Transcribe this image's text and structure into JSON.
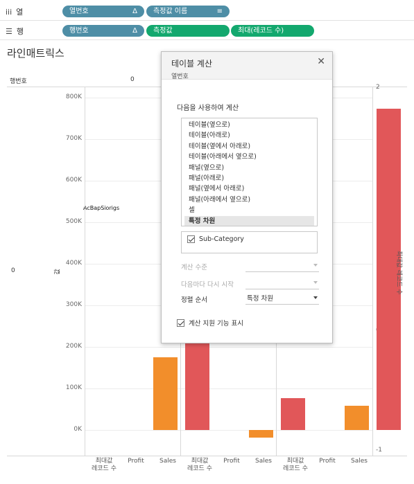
{
  "shelves": {
    "columns": {
      "label": "열",
      "pills": [
        {
          "text": "열번호",
          "mark": "Δ"
        },
        {
          "text": "측정값 이름",
          "mark": ""
        }
      ]
    },
    "rows": {
      "label": "행",
      "pills": [
        {
          "text": "행번호",
          "mark": "Δ"
        },
        {
          "text": "측정값",
          "mark": ""
        },
        {
          "text": "최대(레코드 수)",
          "mark": ""
        }
      ]
    }
  },
  "sheet": {
    "title": "라인매트릭스"
  },
  "chart_header": {
    "row_header_label": "행번호",
    "col_value": "0",
    "row_value": "0",
    "left_axis_title": "값",
    "right_axis_title": "최대값 레코드 수",
    "overlap_text": "AcBapSiorigs"
  },
  "chart_data": {
    "type": "bar",
    "left_axis": {
      "ticks": [
        "800K",
        "700K",
        "600K",
        "500K",
        "400K",
        "300K",
        "200K",
        "100K",
        "0K"
      ]
    },
    "right_axis": {
      "ticks": [
        "2",
        "1",
        "0",
        "-1"
      ]
    },
    "panes": [
      {
        "categories": [
          "최대값 레코드 수",
          "Profit",
          "Sales"
        ],
        "values": [
          0,
          175000,
          738000
        ]
      },
      {
        "categories": [
          "최대값 레코드 수",
          "Profit",
          "Sales"
        ],
        "values": [
          0,
          -19000,
          76000
        ]
      },
      {
        "categories": [
          "최대값 레코드 수",
          "Profit",
          "Sales"
        ],
        "values": [
          0,
          58000,
          773000
        ]
      }
    ],
    "colors": {
      "Profit": "#f28e2b",
      "Sales": "#e15759"
    },
    "x_labels": [
      {
        "line1": "최대값",
        "line2": "레코드 수"
      },
      {
        "line1": "Profit",
        "line2": ""
      },
      {
        "line1": "Sales",
        "line2": ""
      },
      {
        "line1": "최대값",
        "line2": "레코드 수"
      },
      {
        "line1": "Profit",
        "line2": ""
      },
      {
        "line1": "Sales",
        "line2": ""
      },
      {
        "line1": "최대값",
        "line2": "레코드 수"
      },
      {
        "line1": "Profit",
        "line2": ""
      },
      {
        "line1": "Sales",
        "line2": ""
      }
    ]
  },
  "dialog": {
    "title": "테이블 계산",
    "subtitle": "열번호",
    "close_icon": "close-icon",
    "compute_label": "다음을 사용하여 계산",
    "options": [
      "테이블(옆으로)",
      "테이블(아래로)",
      "테이블(옆에서 아래로)",
      "테이블(아래에서 옆으로)",
      "패널(옆으로)",
      "패널(아래로)",
      "패널(옆에서 아래로)",
      "패널(아래에서 옆으로)",
      "셀",
      "특정 차원"
    ],
    "selected": "특정 차원",
    "dimension": "Sub-Category",
    "level_label": "계산 수준",
    "restart_label": "다음마다 다시 시작",
    "sort_label": "정렬 순서",
    "sort_value": "특정 차원",
    "show_help": "계산 지원 기능 표시"
  }
}
